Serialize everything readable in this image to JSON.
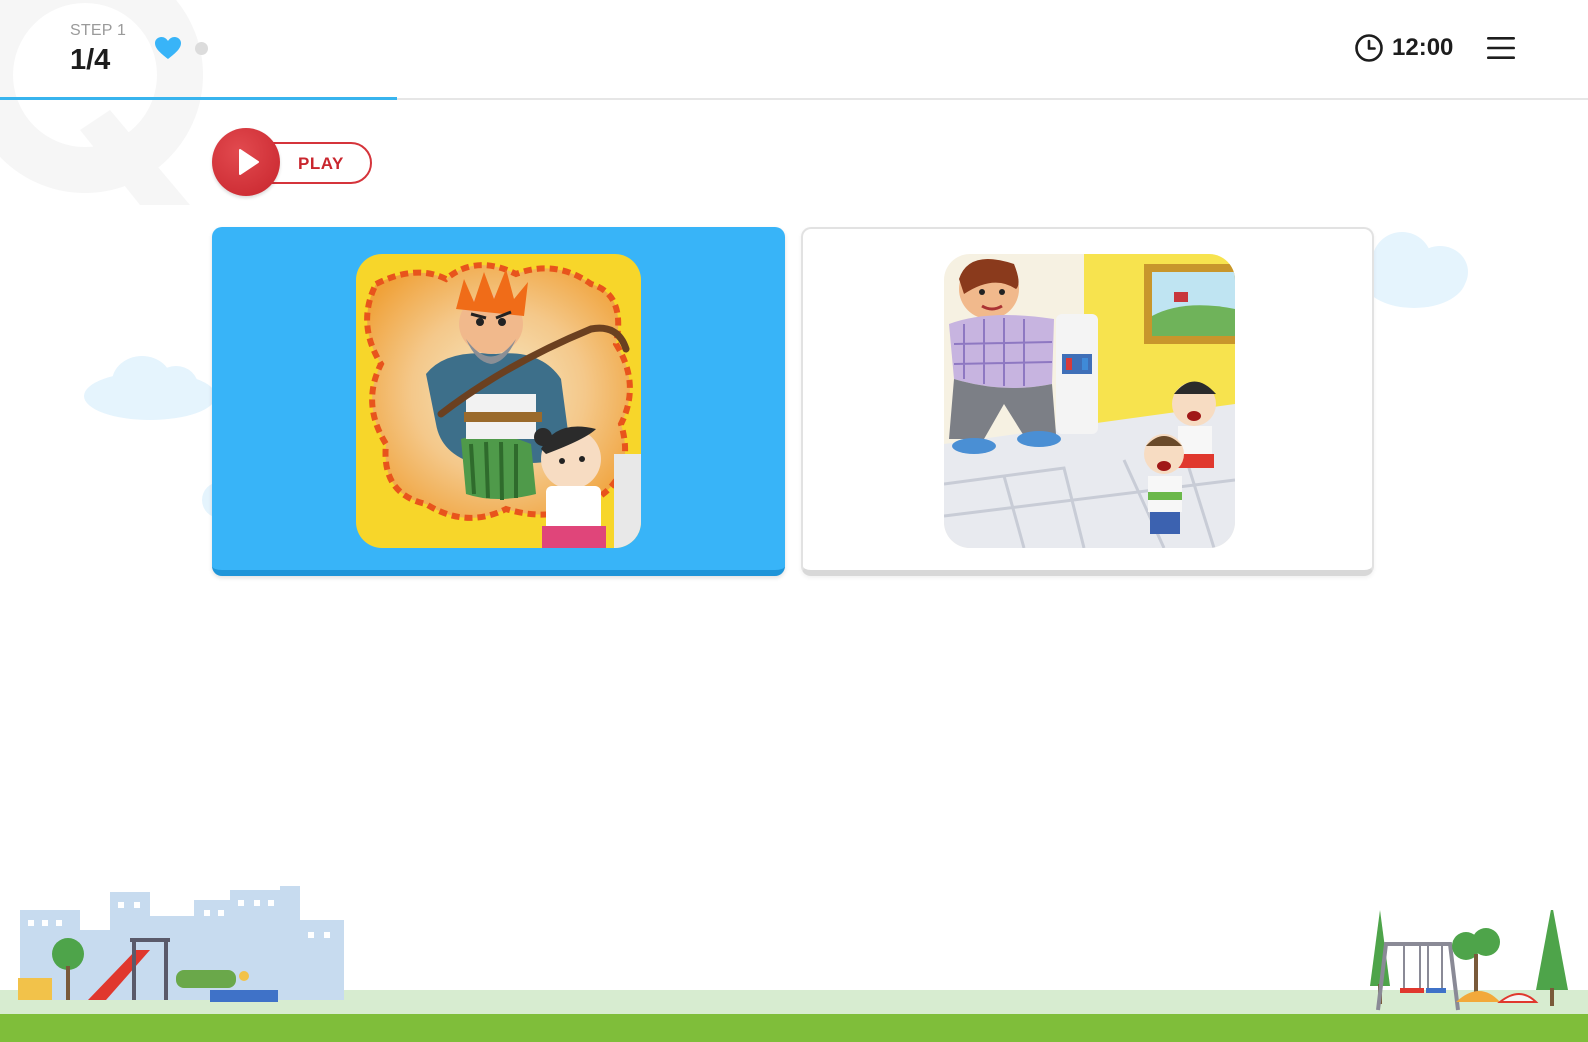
{
  "header": {
    "step_label": "STEP 1",
    "step_count": "1/4",
    "lives_icon": "heart-icon",
    "timer_icon": "clock-icon",
    "timer_text": "12:00",
    "menu_icon": "hamburger-menu-icon",
    "progress_fraction": 0.25
  },
  "play": {
    "icon": "play-icon",
    "label": "PLAY"
  },
  "choices": [
    {
      "id": "choice-1",
      "selected": true,
      "illustration": "angry old man with cane scaring a girl"
    },
    {
      "id": "choice-2",
      "selected": false,
      "illustration": "man at water cooler with two surprised children"
    }
  ],
  "colors": {
    "accent_blue": "#38b4f8",
    "play_red": "#c9262e",
    "grass_green": "#7fbe3a"
  }
}
